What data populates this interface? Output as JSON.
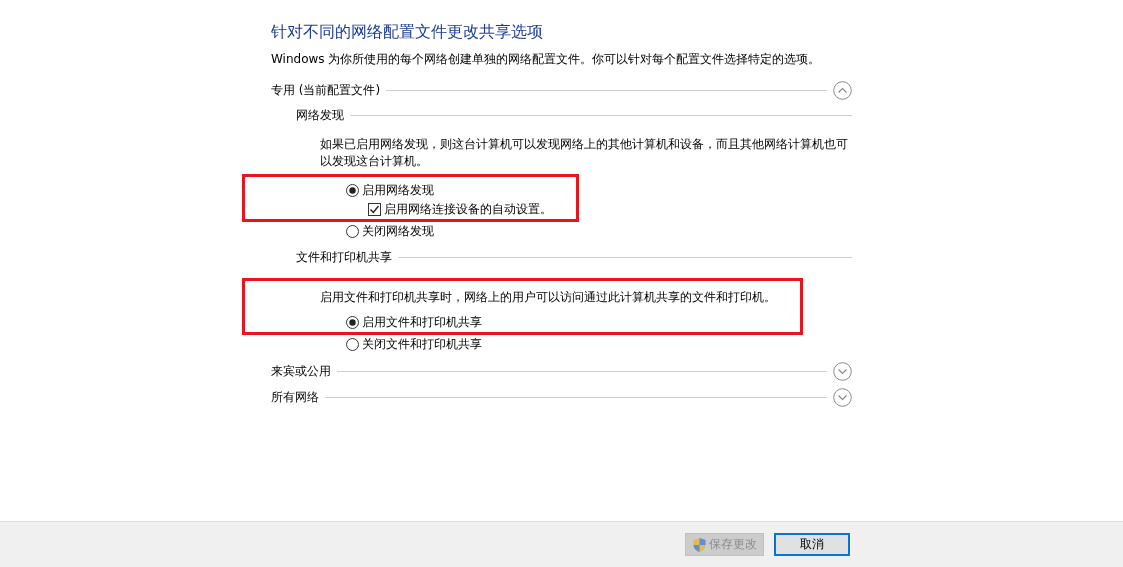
{
  "title": "针对不同的网络配置文件更改共享选项",
  "intro": "Windows 为你所使用的每个网络创建单独的网络配置文件。你可以针对每个配置文件选择特定的选项。",
  "profiles": [
    {
      "label": "专用 (当前配置文件)",
      "expanded": true,
      "subsections": [
        {
          "label": "网络发现",
          "items": [
            {
              "kind": "text",
              "text": "如果已启用网络发现，则这台计算机可以发现网络上的其他计算机和设备，而且其他网络计算机也可以发现这台计算机。",
              "highlighted": false
            },
            {
              "kind": "radio",
              "text": "启用网络发现",
              "selected": true,
              "highlighted": true
            },
            {
              "kind": "checkbox",
              "text": "启用网络连接设备的自动设置。",
              "checked": true,
              "highlighted": true
            },
            {
              "kind": "radio",
              "text": "关闭网络发现",
              "selected": false,
              "highlighted": false
            }
          ]
        },
        {
          "label": "文件和打印机共享",
          "items": [
            {
              "kind": "text",
              "text": "启用文件和打印机共享时，网络上的用户可以访问通过此计算机共享的文件和打印机。",
              "highlighted": true
            },
            {
              "kind": "radio",
              "text": "启用文件和打印机共享",
              "selected": true,
              "highlighted": true
            },
            {
              "kind": "radio",
              "text": "关闭文件和打印机共享",
              "selected": false,
              "highlighted": false
            }
          ]
        }
      ]
    },
    {
      "label": "来宾或公用",
      "expanded": false
    },
    {
      "label": "所有网络",
      "expanded": false
    }
  ],
  "buttons": [
    {
      "label": "保存更改",
      "disabled": true,
      "shield": true,
      "default": false
    },
    {
      "label": "取消",
      "disabled": false,
      "shield": false,
      "default": true
    }
  ]
}
